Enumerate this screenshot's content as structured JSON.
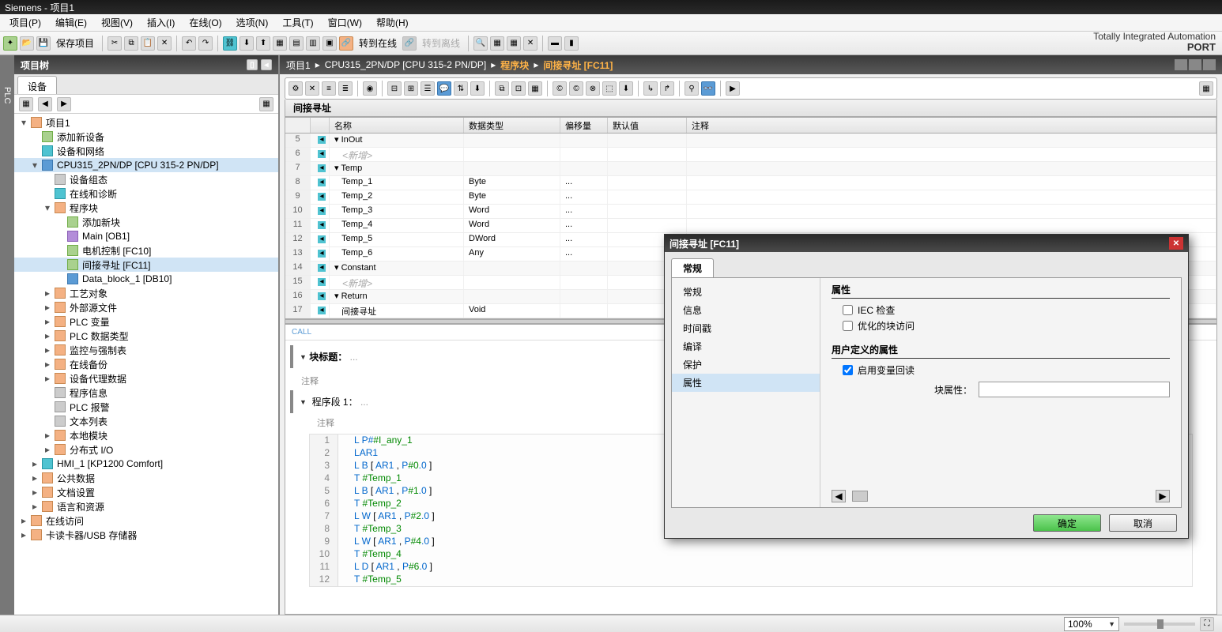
{
  "app": {
    "title": "Siemens - 项目1"
  },
  "menu": [
    "项目(P)",
    "编辑(E)",
    "视图(V)",
    "插入(I)",
    "在线(O)",
    "选项(N)",
    "工具(T)",
    "窗口(W)",
    "帮助(H)"
  ],
  "toolbar": {
    "save_project": "保存项目",
    "go_online": "转到在线",
    "go_offline": "转到离线",
    "brand_line1": "Totally Integrated Automation",
    "brand_line2": "PORT"
  },
  "project_tree": {
    "title": "项目树",
    "tab": "设备",
    "nodes": [
      {
        "depth": 0,
        "expand": "▾",
        "icon": "folder",
        "label": "项目1"
      },
      {
        "depth": 1,
        "expand": "",
        "icon": "add",
        "label": "添加新设备"
      },
      {
        "depth": 1,
        "expand": "",
        "icon": "net",
        "label": "设备和网络"
      },
      {
        "depth": 1,
        "expand": "▾",
        "icon": "plc",
        "label": "CPU315_2PN/DP [CPU 315-2 PN/DP]",
        "sel": true
      },
      {
        "depth": 2,
        "expand": "",
        "icon": "cfg",
        "label": "设备组态"
      },
      {
        "depth": 2,
        "expand": "",
        "icon": "diag",
        "label": "在线和诊断"
      },
      {
        "depth": 2,
        "expand": "▾",
        "icon": "blocks",
        "label": "程序块"
      },
      {
        "depth": 3,
        "expand": "",
        "icon": "add",
        "label": "添加新块"
      },
      {
        "depth": 3,
        "expand": "",
        "icon": "ob",
        "label": "Main [OB1]"
      },
      {
        "depth": 3,
        "expand": "",
        "icon": "fc",
        "label": "电机控制 [FC10]"
      },
      {
        "depth": 3,
        "expand": "",
        "icon": "fc",
        "label": "间接寻址 [FC11]",
        "sel": true
      },
      {
        "depth": 3,
        "expand": "",
        "icon": "db",
        "label": "Data_block_1 [DB10]"
      },
      {
        "depth": 2,
        "expand": "▸",
        "icon": "folder",
        "label": "工艺对象"
      },
      {
        "depth": 2,
        "expand": "▸",
        "icon": "folder",
        "label": "外部源文件"
      },
      {
        "depth": 2,
        "expand": "▸",
        "icon": "folder",
        "label": "PLC 变量"
      },
      {
        "depth": 2,
        "expand": "▸",
        "icon": "folder",
        "label": "PLC 数据类型"
      },
      {
        "depth": 2,
        "expand": "▸",
        "icon": "folder",
        "label": "监控与强制表"
      },
      {
        "depth": 2,
        "expand": "▸",
        "icon": "folder",
        "label": "在线备份"
      },
      {
        "depth": 2,
        "expand": "▸",
        "icon": "folder",
        "label": "设备代理数据"
      },
      {
        "depth": 2,
        "expand": "",
        "icon": "info",
        "label": "程序信息"
      },
      {
        "depth": 2,
        "expand": "",
        "icon": "alarm",
        "label": "PLC 报警"
      },
      {
        "depth": 2,
        "expand": "",
        "icon": "text",
        "label": "文本列表"
      },
      {
        "depth": 2,
        "expand": "▸",
        "icon": "folder",
        "label": "本地模块"
      },
      {
        "depth": 2,
        "expand": "▸",
        "icon": "folder",
        "label": "分布式 I/O"
      },
      {
        "depth": 1,
        "expand": "▸",
        "icon": "hmi",
        "label": "HMI_1 [KP1200 Comfort]"
      },
      {
        "depth": 1,
        "expand": "▸",
        "icon": "folder",
        "label": "公共数据"
      },
      {
        "depth": 1,
        "expand": "▸",
        "icon": "folder",
        "label": "文档设置"
      },
      {
        "depth": 1,
        "expand": "▸",
        "icon": "folder",
        "label": "语言和资源"
      },
      {
        "depth": 0,
        "expand": "▸",
        "icon": "folder",
        "label": "在线访问"
      },
      {
        "depth": 0,
        "expand": "▸",
        "icon": "folder",
        "label": "卡读卡器/USB 存储器"
      }
    ]
  },
  "breadcrumb": [
    "项目1",
    "CPU315_2PN/DP [CPU 315-2 PN/DP]",
    "程序块",
    "间接寻址 [FC11]"
  ],
  "block_name": "间接寻址",
  "var_table": {
    "head": [
      "",
      "",
      "名称",
      "数据类型",
      "偏移量",
      "默认值",
      "注释"
    ],
    "rows": [
      {
        "n": "5",
        "section": true,
        "name": "InOut",
        "type": "",
        "off": "",
        "def": ""
      },
      {
        "n": "6",
        "section": false,
        "name": "<新增>",
        "type": "",
        "off": "",
        "def": "",
        "ph": true
      },
      {
        "n": "7",
        "section": true,
        "name": "Temp",
        "type": "",
        "off": "",
        "def": ""
      },
      {
        "n": "8",
        "section": false,
        "name": "Temp_1",
        "type": "Byte",
        "off": "...",
        "def": ""
      },
      {
        "n": "9",
        "section": false,
        "name": "Temp_2",
        "type": "Byte",
        "off": "...",
        "def": ""
      },
      {
        "n": "10",
        "section": false,
        "name": "Temp_3",
        "type": "Word",
        "off": "...",
        "def": ""
      },
      {
        "n": "11",
        "section": false,
        "name": "Temp_4",
        "type": "Word",
        "off": "...",
        "def": ""
      },
      {
        "n": "12",
        "section": false,
        "name": "Temp_5",
        "type": "DWord",
        "off": "...",
        "def": ""
      },
      {
        "n": "13",
        "section": false,
        "name": "Temp_6",
        "type": "Any",
        "off": "...",
        "def": ""
      },
      {
        "n": "14",
        "section": true,
        "name": "Constant",
        "type": "",
        "off": "",
        "def": ""
      },
      {
        "n": "15",
        "section": false,
        "name": "<新增>",
        "type": "",
        "off": "",
        "def": "",
        "ph": true
      },
      {
        "n": "16",
        "section": true,
        "name": "Return",
        "type": "",
        "off": "",
        "def": ""
      },
      {
        "n": "17",
        "section": false,
        "name": "间接寻址",
        "type": "Void",
        "off": "",
        "def": ""
      }
    ]
  },
  "code": {
    "call_tag": "CALL",
    "block_title_label": "块标题：",
    "block_title_value": "...",
    "comment_label": "注释",
    "segment_label": "程序段 1：",
    "segment_value": "...",
    "lines": [
      {
        "n": 1,
        "t": "L     P##I_any_1"
      },
      {
        "n": 2,
        "t": "LAR1"
      },
      {
        "n": 3,
        "t": "L B [ AR1 , P#0.0 ]"
      },
      {
        "n": 4,
        "t": "T     #Temp_1"
      },
      {
        "n": 5,
        "t": "L B [ AR1 , P#1.0 ]"
      },
      {
        "n": 6,
        "t": "T     #Temp_2"
      },
      {
        "n": 7,
        "t": "L W [ AR1 , P#2.0 ]"
      },
      {
        "n": 8,
        "t": "T     #Temp_3"
      },
      {
        "n": 9,
        "t": "L W [ AR1 , P#4.0 ]"
      },
      {
        "n": 10,
        "t": "T     #Temp_4"
      },
      {
        "n": 11,
        "t": "L D [ AR1 , P#6.0 ]"
      },
      {
        "n": 12,
        "t": "T     #Temp_5"
      }
    ]
  },
  "dialog": {
    "title": "间接寻址 [FC11]",
    "tab": "常规",
    "nav": [
      "常规",
      "信息",
      "时间戳",
      "编译",
      "保护",
      "属性"
    ],
    "nav_selected": "属性",
    "section1": "属性",
    "cb_iec": "IEC 检查",
    "cb_opt": "优化的块访问",
    "section2": "用户定义的属性",
    "cb_readback": "启用变量回读",
    "field_label": "块属性：",
    "ok": "确定",
    "cancel": "取消"
  },
  "status": {
    "zoom": "100%"
  }
}
